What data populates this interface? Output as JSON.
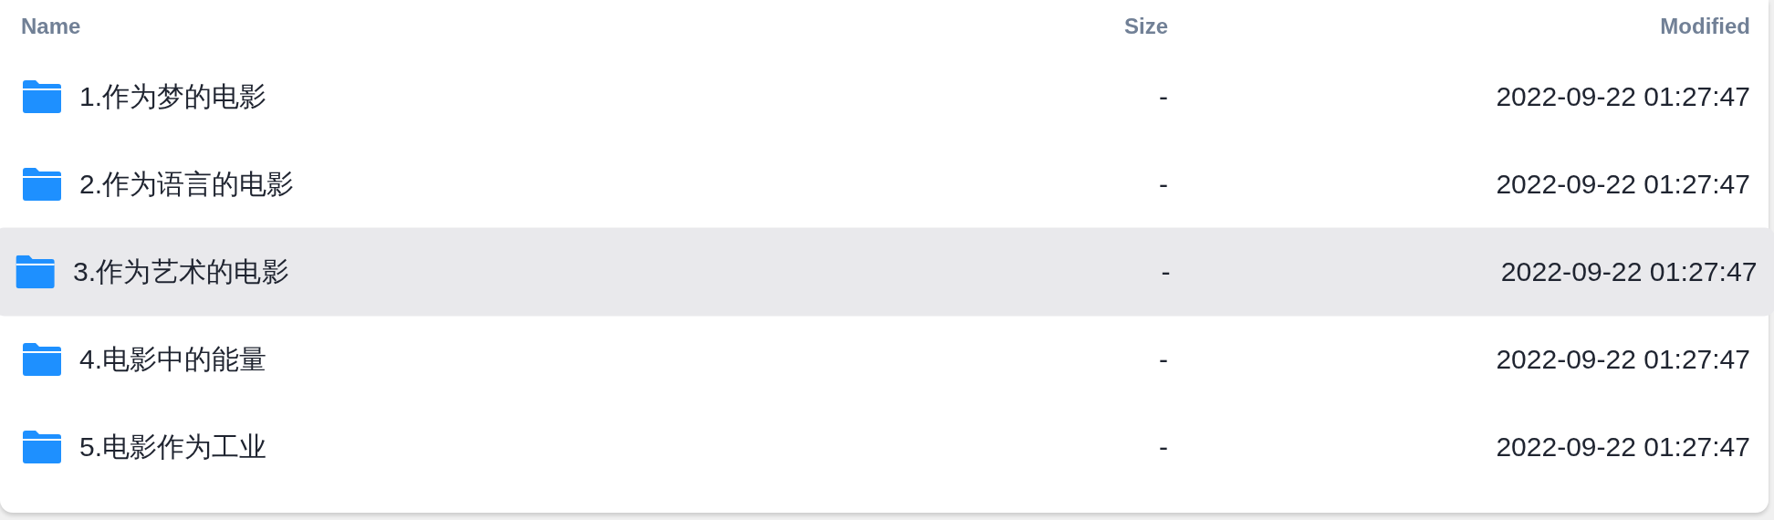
{
  "table": {
    "columns": [
      "Name",
      "Size",
      "Modified"
    ],
    "rows": [
      {
        "name": "1.作为梦的电影",
        "size": "-",
        "modified": "2022-09-22 01:27:47",
        "selected": false
      },
      {
        "name": "2.作为语言的电影",
        "size": "-",
        "modified": "2022-09-22 01:27:47",
        "selected": false
      },
      {
        "name": "3.作为艺术的电影",
        "size": "-",
        "modified": "2022-09-22 01:27:47",
        "selected": true
      },
      {
        "name": "4.电影中的能量",
        "size": "-",
        "modified": "2022-09-22 01:27:47",
        "selected": false
      },
      {
        "name": "5.电影作为工业",
        "size": "-",
        "modified": "2022-09-22 01:27:47",
        "selected": false
      }
    ]
  }
}
